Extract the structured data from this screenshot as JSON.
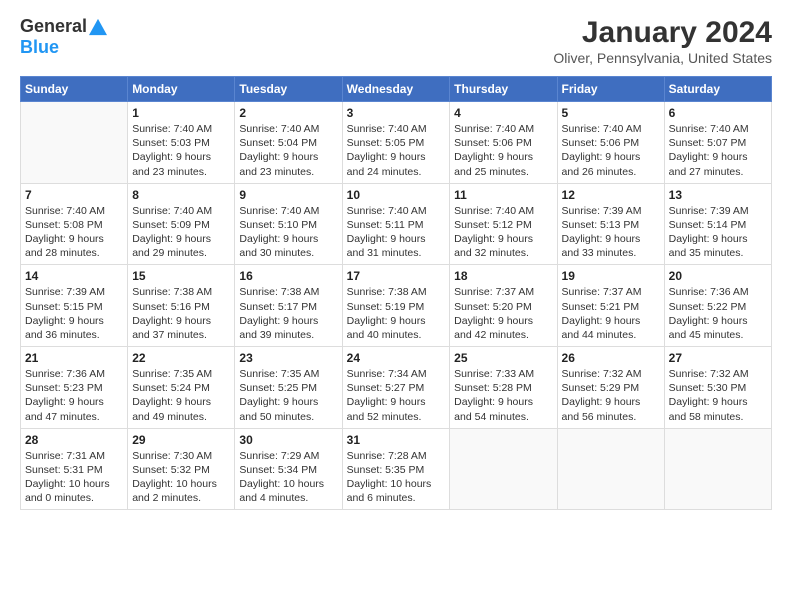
{
  "logo": {
    "general": "General",
    "blue": "Blue"
  },
  "header": {
    "title": "January 2024",
    "subtitle": "Oliver, Pennsylvania, United States"
  },
  "calendar": {
    "days_of_week": [
      "Sunday",
      "Monday",
      "Tuesday",
      "Wednesday",
      "Thursday",
      "Friday",
      "Saturday"
    ],
    "weeks": [
      [
        {
          "day": "",
          "info": ""
        },
        {
          "day": "1",
          "info": "Sunrise: 7:40 AM\nSunset: 5:03 PM\nDaylight: 9 hours\nand 23 minutes."
        },
        {
          "day": "2",
          "info": "Sunrise: 7:40 AM\nSunset: 5:04 PM\nDaylight: 9 hours\nand 23 minutes."
        },
        {
          "day": "3",
          "info": "Sunrise: 7:40 AM\nSunset: 5:05 PM\nDaylight: 9 hours\nand 24 minutes."
        },
        {
          "day": "4",
          "info": "Sunrise: 7:40 AM\nSunset: 5:06 PM\nDaylight: 9 hours\nand 25 minutes."
        },
        {
          "day": "5",
          "info": "Sunrise: 7:40 AM\nSunset: 5:06 PM\nDaylight: 9 hours\nand 26 minutes."
        },
        {
          "day": "6",
          "info": "Sunrise: 7:40 AM\nSunset: 5:07 PM\nDaylight: 9 hours\nand 27 minutes."
        }
      ],
      [
        {
          "day": "7",
          "info": "Sunrise: 7:40 AM\nSunset: 5:08 PM\nDaylight: 9 hours\nand 28 minutes."
        },
        {
          "day": "8",
          "info": "Sunrise: 7:40 AM\nSunset: 5:09 PM\nDaylight: 9 hours\nand 29 minutes."
        },
        {
          "day": "9",
          "info": "Sunrise: 7:40 AM\nSunset: 5:10 PM\nDaylight: 9 hours\nand 30 minutes."
        },
        {
          "day": "10",
          "info": "Sunrise: 7:40 AM\nSunset: 5:11 PM\nDaylight: 9 hours\nand 31 minutes."
        },
        {
          "day": "11",
          "info": "Sunrise: 7:40 AM\nSunset: 5:12 PM\nDaylight: 9 hours\nand 32 minutes."
        },
        {
          "day": "12",
          "info": "Sunrise: 7:39 AM\nSunset: 5:13 PM\nDaylight: 9 hours\nand 33 minutes."
        },
        {
          "day": "13",
          "info": "Sunrise: 7:39 AM\nSunset: 5:14 PM\nDaylight: 9 hours\nand 35 minutes."
        }
      ],
      [
        {
          "day": "14",
          "info": "Sunrise: 7:39 AM\nSunset: 5:15 PM\nDaylight: 9 hours\nand 36 minutes."
        },
        {
          "day": "15",
          "info": "Sunrise: 7:38 AM\nSunset: 5:16 PM\nDaylight: 9 hours\nand 37 minutes."
        },
        {
          "day": "16",
          "info": "Sunrise: 7:38 AM\nSunset: 5:17 PM\nDaylight: 9 hours\nand 39 minutes."
        },
        {
          "day": "17",
          "info": "Sunrise: 7:38 AM\nSunset: 5:19 PM\nDaylight: 9 hours\nand 40 minutes."
        },
        {
          "day": "18",
          "info": "Sunrise: 7:37 AM\nSunset: 5:20 PM\nDaylight: 9 hours\nand 42 minutes."
        },
        {
          "day": "19",
          "info": "Sunrise: 7:37 AM\nSunset: 5:21 PM\nDaylight: 9 hours\nand 44 minutes."
        },
        {
          "day": "20",
          "info": "Sunrise: 7:36 AM\nSunset: 5:22 PM\nDaylight: 9 hours\nand 45 minutes."
        }
      ],
      [
        {
          "day": "21",
          "info": "Sunrise: 7:36 AM\nSunset: 5:23 PM\nDaylight: 9 hours\nand 47 minutes."
        },
        {
          "day": "22",
          "info": "Sunrise: 7:35 AM\nSunset: 5:24 PM\nDaylight: 9 hours\nand 49 minutes."
        },
        {
          "day": "23",
          "info": "Sunrise: 7:35 AM\nSunset: 5:25 PM\nDaylight: 9 hours\nand 50 minutes."
        },
        {
          "day": "24",
          "info": "Sunrise: 7:34 AM\nSunset: 5:27 PM\nDaylight: 9 hours\nand 52 minutes."
        },
        {
          "day": "25",
          "info": "Sunrise: 7:33 AM\nSunset: 5:28 PM\nDaylight: 9 hours\nand 54 minutes."
        },
        {
          "day": "26",
          "info": "Sunrise: 7:32 AM\nSunset: 5:29 PM\nDaylight: 9 hours\nand 56 minutes."
        },
        {
          "day": "27",
          "info": "Sunrise: 7:32 AM\nSunset: 5:30 PM\nDaylight: 9 hours\nand 58 minutes."
        }
      ],
      [
        {
          "day": "28",
          "info": "Sunrise: 7:31 AM\nSunset: 5:31 PM\nDaylight: 10 hours\nand 0 minutes."
        },
        {
          "day": "29",
          "info": "Sunrise: 7:30 AM\nSunset: 5:32 PM\nDaylight: 10 hours\nand 2 minutes."
        },
        {
          "day": "30",
          "info": "Sunrise: 7:29 AM\nSunset: 5:34 PM\nDaylight: 10 hours\nand 4 minutes."
        },
        {
          "day": "31",
          "info": "Sunrise: 7:28 AM\nSunset: 5:35 PM\nDaylight: 10 hours\nand 6 minutes."
        },
        {
          "day": "",
          "info": ""
        },
        {
          "day": "",
          "info": ""
        },
        {
          "day": "",
          "info": ""
        }
      ]
    ]
  }
}
